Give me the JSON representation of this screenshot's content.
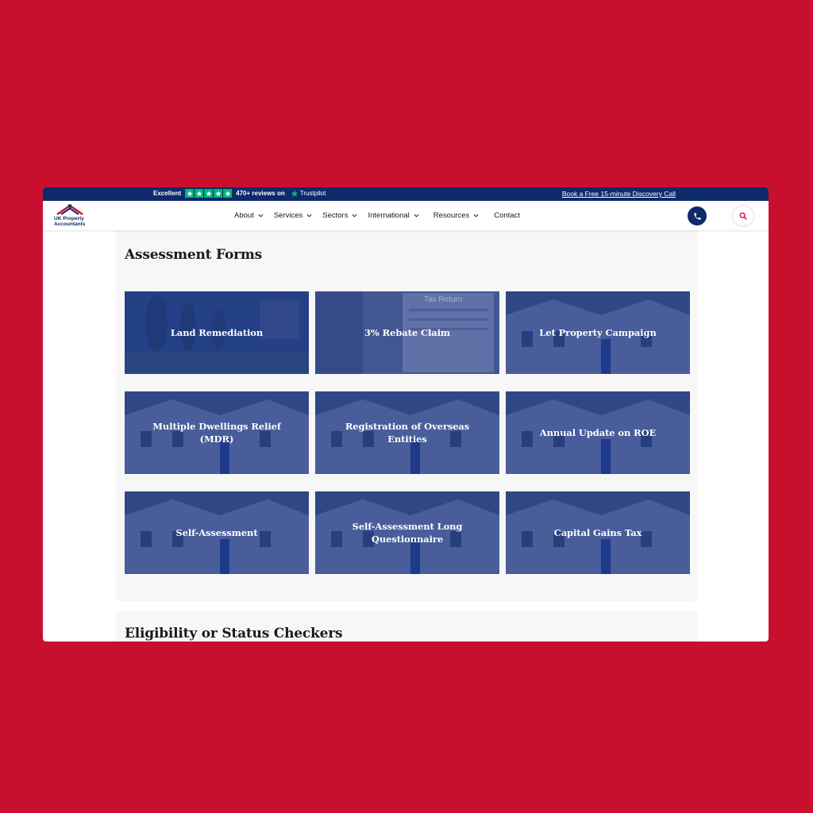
{
  "topbar": {
    "rating_word": "Excellent",
    "reviews_text": "470+ reviews on",
    "trustpilot_label": "Trustpilot",
    "cta_link": "Book a Free 15-minute Discovery Call"
  },
  "header": {
    "logo_text_line1": "UK Property",
    "logo_text_line2": "Accountants",
    "nav": [
      "About",
      "Services",
      "Sectors",
      "International",
      "Resources",
      "Contact"
    ]
  },
  "sections": [
    {
      "title": "Assessment Forms",
      "cards": [
        {
          "label": "Land Remediation"
        },
        {
          "label": "3% Rebate Claim"
        },
        {
          "label": "Let Property Campaign"
        },
        {
          "label": "Multiple Dwellings Relief (MDR)"
        },
        {
          "label": "Registration of Overseas Entities"
        },
        {
          "label": "Annual Update on ROE"
        },
        {
          "label": "Self-Assessment"
        },
        {
          "label": "Self-Assessment Long Questionnaire"
        },
        {
          "label": "Capital Gains Tax"
        }
      ]
    },
    {
      "title": "Eligibility or Status Checkers"
    }
  ],
  "tax_return_label": "Tax Return",
  "colors": {
    "page_background": "#c8102e",
    "brand_navy": "#0f2a6b",
    "card_overlay": "#163082",
    "trustpilot_green": "#00b67a"
  }
}
